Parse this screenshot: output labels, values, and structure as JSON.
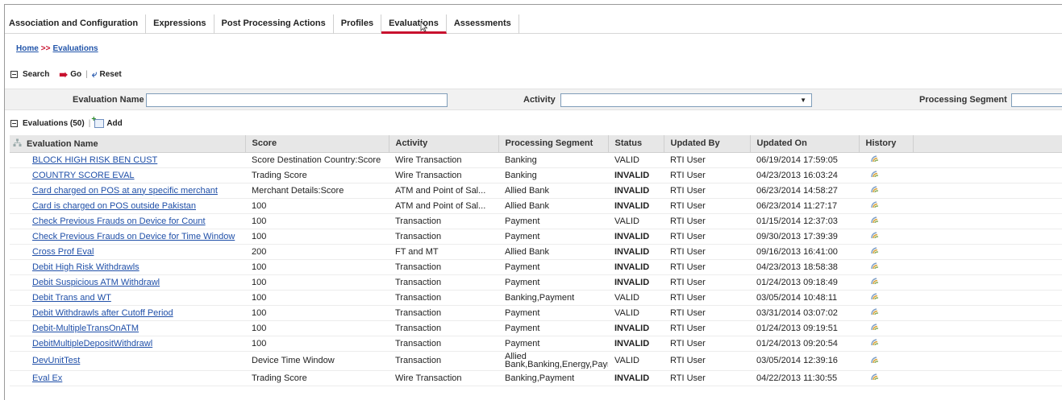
{
  "tabs": [
    {
      "label": "Association and Configuration",
      "active": false
    },
    {
      "label": "Expressions",
      "active": false
    },
    {
      "label": "Post Processing Actions",
      "active": false
    },
    {
      "label": "Profiles",
      "active": false
    },
    {
      "label": "Evaluations",
      "active": true
    },
    {
      "label": "Assessments",
      "active": false
    }
  ],
  "breadcrumb": {
    "home": "Home",
    "separator": ">>",
    "current": "Evaluations"
  },
  "search": {
    "title": "Search",
    "go_label": "Go",
    "reset_label": "Reset"
  },
  "search_fields": {
    "evaluation_name_label": "Evaluation Name",
    "evaluation_name_value": "",
    "activity_label": "Activity",
    "activity_value": "",
    "processing_segment_label": "Processing Segment",
    "processing_segment_value": ""
  },
  "grid": {
    "title": "Evaluations (50)",
    "add_label": "Add",
    "columns": [
      "Evaluation Name",
      "Score",
      "Activity",
      "Processing Segment",
      "Status",
      "Updated By",
      "Updated On",
      "History"
    ],
    "rows": [
      {
        "name": "BLOCK HIGH RISK BEN CUST",
        "score": "Score Destination Country:Score",
        "activity": "Wire Transaction",
        "segment": "Banking",
        "status": "VALID",
        "updated_by": "RTI User",
        "updated_on": "06/19/2014 17:59:05"
      },
      {
        "name": "COUNTRY SCORE EVAL",
        "score": "Trading Score",
        "activity": "Wire Transaction",
        "segment": "Banking",
        "status": "INVALID",
        "updated_by": "RTI User",
        "updated_on": "04/23/2013 16:03:24"
      },
      {
        "name": "Card charged on POS at any specific merchant",
        "score": "Merchant Details:Score",
        "activity": "ATM and Point of Sal...",
        "segment": "Allied Bank",
        "status": "INVALID",
        "updated_by": "RTI User",
        "updated_on": "06/23/2014 14:58:27"
      },
      {
        "name": "Card is charged on POS outside Pakistan",
        "score": "100",
        "activity": "ATM and Point of Sal...",
        "segment": "Allied Bank",
        "status": "INVALID",
        "updated_by": "RTI User",
        "updated_on": "06/23/2014 11:27:17"
      },
      {
        "name": "Check Previous Frauds on Device for Count",
        "score": "100",
        "activity": "Transaction",
        "segment": "Payment",
        "status": "VALID",
        "updated_by": "RTI User",
        "updated_on": "01/15/2014 12:37:03"
      },
      {
        "name": "Check Previous Frauds on Device for Time Window",
        "score": "100",
        "activity": "Transaction",
        "segment": "Payment",
        "status": "INVALID",
        "updated_by": "RTI User",
        "updated_on": "09/30/2013 17:39:39"
      },
      {
        "name": "Cross Prof Eval",
        "score": "200",
        "activity": "FT and MT",
        "segment": "Allied Bank",
        "status": "INVALID",
        "updated_by": "RTI User",
        "updated_on": "09/16/2013 16:41:00"
      },
      {
        "name": "Debit High Risk Withdrawls",
        "score": "100",
        "activity": "Transaction",
        "segment": "Payment",
        "status": "INVALID",
        "updated_by": "RTI User",
        "updated_on": "04/23/2013 18:58:38"
      },
      {
        "name": "Debit Suspicious ATM Withdrawl",
        "score": "100",
        "activity": "Transaction",
        "segment": "Payment",
        "status": "INVALID",
        "updated_by": "RTI User",
        "updated_on": "01/24/2013 09:18:49"
      },
      {
        "name": "Debit Trans and WT",
        "score": "100",
        "activity": "Transaction",
        "segment": "Banking,Payment",
        "status": "VALID",
        "updated_by": "RTI User",
        "updated_on": "03/05/2014 10:48:11"
      },
      {
        "name": "Debit Withdrawls after Cutoff Period",
        "score": "100",
        "activity": "Transaction",
        "segment": "Payment",
        "status": "VALID",
        "updated_by": "RTI User",
        "updated_on": "03/31/2014 03:07:02"
      },
      {
        "name": "Debit-MultipleTransOnATM",
        "score": "100",
        "activity": "Transaction",
        "segment": "Payment",
        "status": "INVALID",
        "updated_by": "RTI User",
        "updated_on": "01/24/2013 09:19:51"
      },
      {
        "name": "DebitMultipleDepositWithdrawl",
        "score": "100",
        "activity": "Transaction",
        "segment": "Payment",
        "status": "INVALID",
        "updated_by": "RTI User",
        "updated_on": "01/24/2013 09:20:54"
      },
      {
        "name": "DevUnitTest",
        "score": "Device Time Window",
        "activity": "Transaction",
        "segment": "Allied Bank,Banking,Energy,Paym",
        "status": "VALID",
        "updated_by": "RTI User",
        "updated_on": "03/05/2014 12:39:16"
      },
      {
        "name": "Eval Ex",
        "score": "Trading Score",
        "activity": "Wire Transaction",
        "segment": "Banking,Payment",
        "status": "INVALID",
        "updated_by": "RTI User",
        "updated_on": "04/22/2013 11:30:55"
      }
    ]
  },
  "colors": {
    "accent_red": "#c8102e",
    "link_blue": "#1f4fa8",
    "invalid_red": "#e00000",
    "header_gray": "#e7e7e7"
  },
  "icons": {
    "go": "arrow-right-icon",
    "reset": "reset-icon",
    "add": "add-icon",
    "history": "history-icon",
    "collapse": "collapse-icon"
  }
}
